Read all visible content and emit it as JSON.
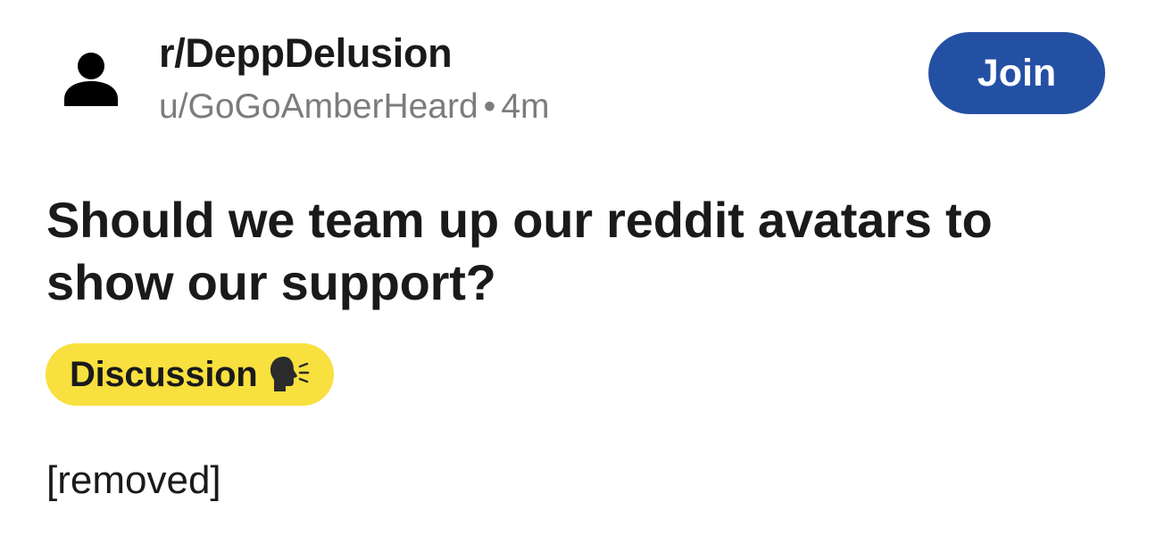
{
  "header": {
    "subreddit": "r/DeppDelusion",
    "username": "u/GoGoAmberHeard",
    "separator": "•",
    "age": "4m",
    "join_label": "Join"
  },
  "post": {
    "title": "Should we team up our reddit avatars to show our support?",
    "flair": {
      "label": "Discussion",
      "icon": "speaking-head-icon",
      "color": "#f8e03e"
    },
    "body": "[removed]"
  },
  "icons": {
    "avatar": "user-avatar-icon"
  },
  "colors": {
    "join_button": "#2450a4",
    "meta_text": "#7c7c7c"
  }
}
